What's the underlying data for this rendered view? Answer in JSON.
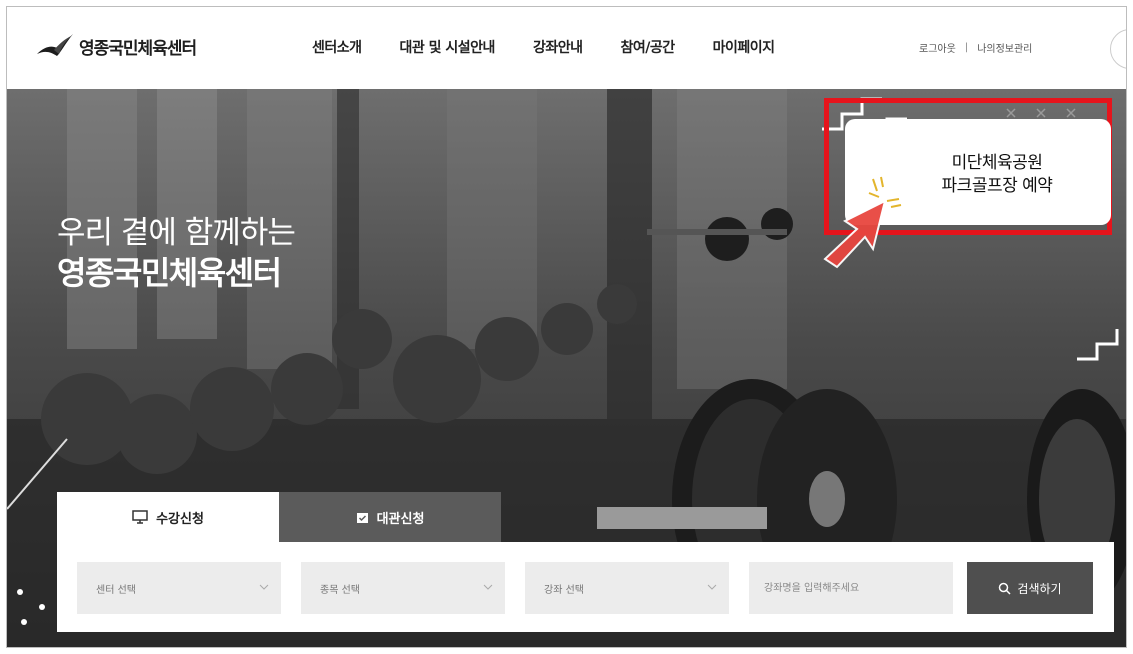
{
  "header": {
    "logo_text": "영종국민체육센터",
    "nav": [
      "센터소개",
      "대관 및 시설안내",
      "강좌안내",
      "참여/공간",
      "마이페이지"
    ],
    "util_links": {
      "logout": "로그아웃",
      "separator": "|",
      "my_info": "나의정보관리"
    }
  },
  "hero": {
    "title_line1": "우리 곁에 함께하는",
    "title_line2": "영종국민체육센터",
    "promo": {
      "line1": "미단체육공원",
      "line2": "파크골프장 예약"
    },
    "highlight_color": "#e6141c",
    "cursor_color": "#e8463f"
  },
  "reservation": {
    "tabs": [
      {
        "label": "수강신청",
        "icon": "monitor-icon",
        "active": true
      },
      {
        "label": "대관신청",
        "icon": "calendar-check-icon",
        "active": false
      }
    ],
    "filters": [
      "센터 선택",
      "종목 선택",
      "강좌 선택"
    ],
    "keyword_placeholder": "강좌명을 입력해주세요",
    "search_label": "검색하기"
  }
}
